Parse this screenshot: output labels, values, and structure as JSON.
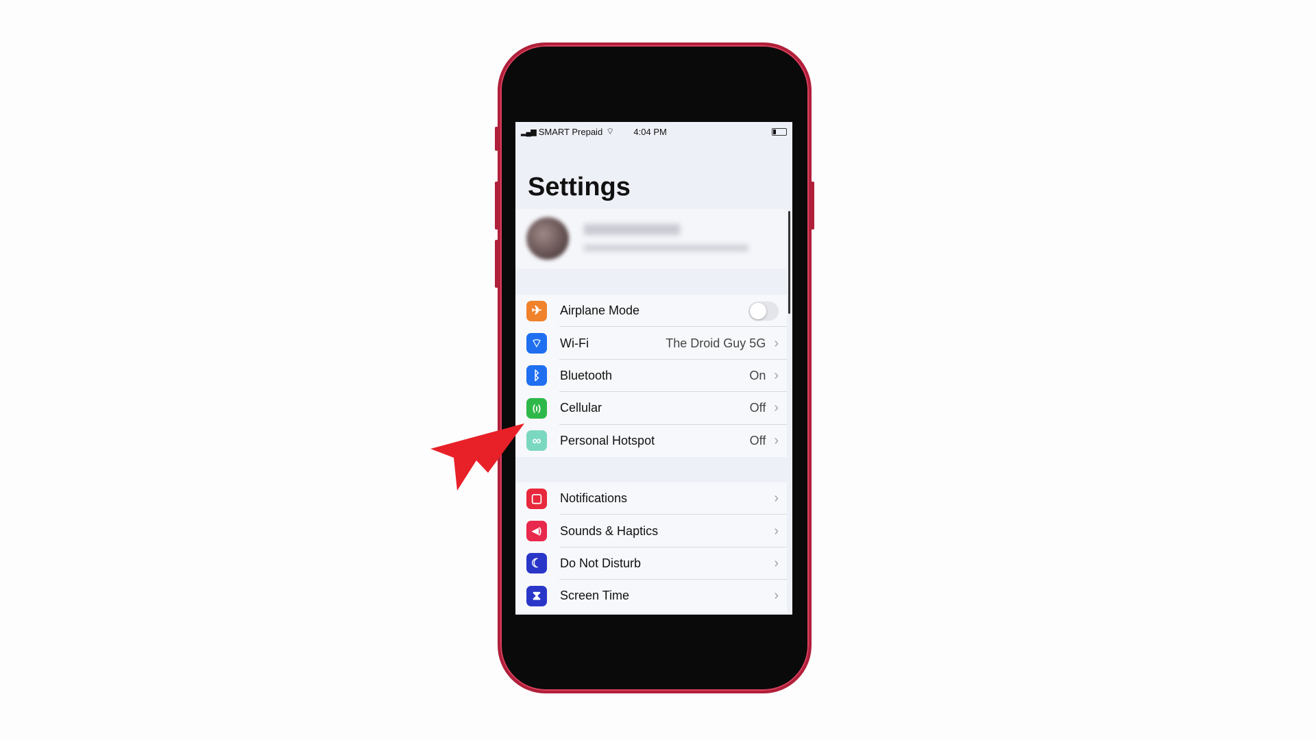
{
  "status_bar": {
    "carrier": "SMART Prepaid",
    "time": "4:04 PM"
  },
  "title": "Settings",
  "group1": [
    {
      "label": "Airplane Mode",
      "icon": "airplane-icon",
      "color": "#f0822c",
      "toggle": false
    },
    {
      "label": "Wi-Fi",
      "icon": "wifi-icon",
      "color": "#1f6ff0",
      "value": "The Droid Guy 5G"
    },
    {
      "label": "Bluetooth",
      "icon": "bluetooth-icon",
      "color": "#1f6ff0",
      "value": "On"
    },
    {
      "label": "Cellular",
      "icon": "antenna-icon",
      "color": "#2fb84a",
      "value": "Off"
    },
    {
      "label": "Personal Hotspot",
      "icon": "hotspot-icon",
      "color": "#7ad8c0",
      "value": "Off"
    }
  ],
  "group2": [
    {
      "label": "Notifications",
      "icon": "notifications-icon",
      "color": "#e8283c"
    },
    {
      "label": "Sounds & Haptics",
      "icon": "speaker-icon",
      "color": "#e8284c"
    },
    {
      "label": "Do Not Disturb",
      "icon": "moon-icon",
      "color": "#2a36c8"
    },
    {
      "label": "Screen Time",
      "icon": "hourglass-icon",
      "color": "#2a36c8"
    }
  ],
  "arrow_color": "#e82028"
}
